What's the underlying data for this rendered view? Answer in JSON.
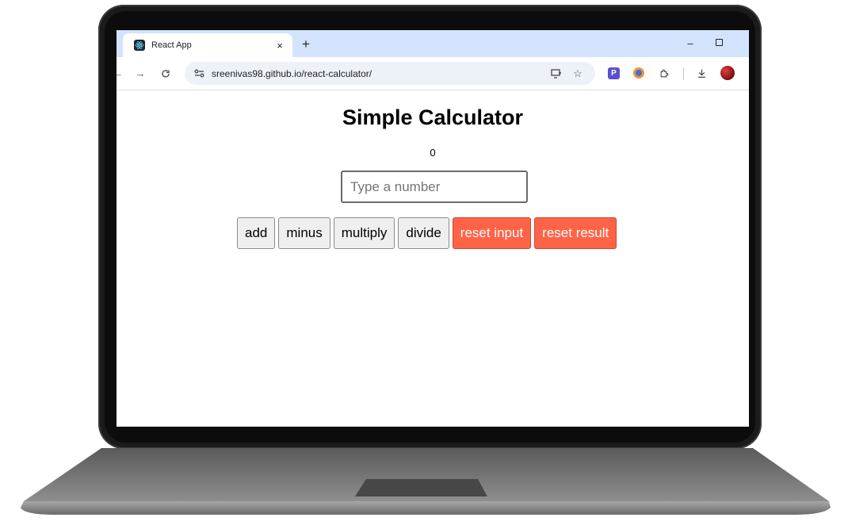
{
  "browser": {
    "tab_title": "React App",
    "tab_close_glyph": "×",
    "new_tab_glyph": "+",
    "minimize_glyph": "–",
    "url": "sreenivas98.github.io/react-calculator/",
    "icons": [
      "back-arrow-icon",
      "forward-arrow-icon",
      "reload-icon",
      "site-info-icon",
      "install-app-icon",
      "bookmark-star-icon",
      "extension-p-icon",
      "extension-circle-icon",
      "extensions-puzzle-icon",
      "download-icon",
      "profile-avatar-icon"
    ],
    "extension_p_label": "P"
  },
  "app": {
    "title": "Simple Calculator",
    "result": "0",
    "input_placeholder": "Type a number",
    "buttons": {
      "add": "add",
      "minus": "minus",
      "multiply": "multiply",
      "divide": "divide",
      "reset_input": "reset input",
      "reset_result": "reset result"
    },
    "colors": {
      "reset_button": "#ff6347",
      "tab_strip": "#d3e3fd"
    }
  }
}
